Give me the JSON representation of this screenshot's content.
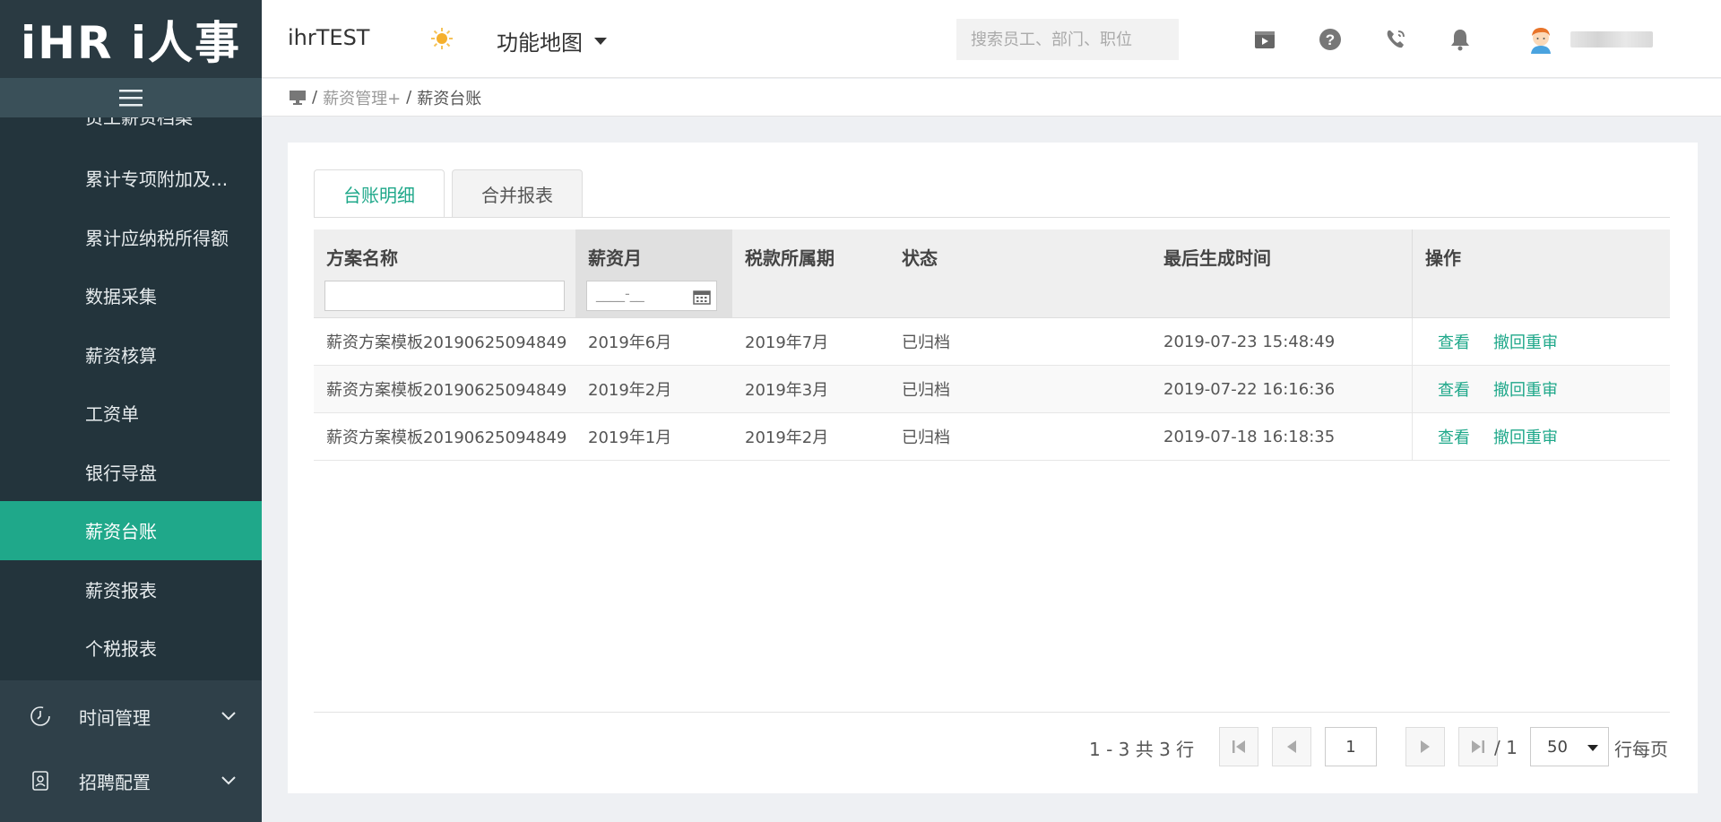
{
  "sidebar": {
    "logo": "iHR i人事",
    "menu_toggle_icon": "hamburger-icon",
    "sub_items": [
      {
        "label": "员工薪资档案",
        "partial": true
      },
      {
        "label": "累计专项附加及..."
      },
      {
        "label": "累计应纳税所得额"
      },
      {
        "label": "数据采集"
      },
      {
        "label": "薪资核算"
      },
      {
        "label": "工资单"
      },
      {
        "label": "银行导盘"
      },
      {
        "label": "薪资台账",
        "active": true
      },
      {
        "label": "薪资报表"
      },
      {
        "label": "个税报表"
      }
    ],
    "groups": [
      {
        "label": "时间管理",
        "icon": "clock-icon"
      },
      {
        "label": "招聘配置",
        "icon": "badge-icon"
      }
    ]
  },
  "header": {
    "company": "ihrTEST",
    "func_map": "功能地图",
    "search_placeholder": "搜索员工、部门、职位"
  },
  "breadcrumb": {
    "parent": "薪资管理+",
    "current": "薪资台账"
  },
  "tabs": [
    {
      "label": "台账明细",
      "active": true
    },
    {
      "label": "合并报表"
    }
  ],
  "table": {
    "columns": [
      "方案名称",
      "薪资月",
      "税款所属期",
      "状态",
      "最后生成时间",
      "操作"
    ],
    "date_placeholder": "____-__",
    "rows": [
      {
        "name": "薪资方案模板20190625094849",
        "month": "2019年6月",
        "tax_period": "2019年7月",
        "status": "已归档",
        "time": "2019-07-23 15:48:49"
      },
      {
        "name": "薪资方案模板20190625094849",
        "month": "2019年2月",
        "tax_period": "2019年3月",
        "status": "已归档",
        "time": "2019-07-22 16:16:36"
      },
      {
        "name": "薪资方案模板20190625094849",
        "month": "2019年1月",
        "tax_period": "2019年2月",
        "status": "已归档",
        "time": "2019-07-18 16:18:35"
      }
    ],
    "op_view": "查看",
    "op_revoke": "撤回重审"
  },
  "pager": {
    "summary": "1 - 3 共 3 行",
    "page": "1",
    "total": "/ 1",
    "page_size": "50",
    "per_page_label": "行每页"
  },
  "colors": {
    "accent": "#1fa88a",
    "sidebar_bg": "#2f4049"
  }
}
